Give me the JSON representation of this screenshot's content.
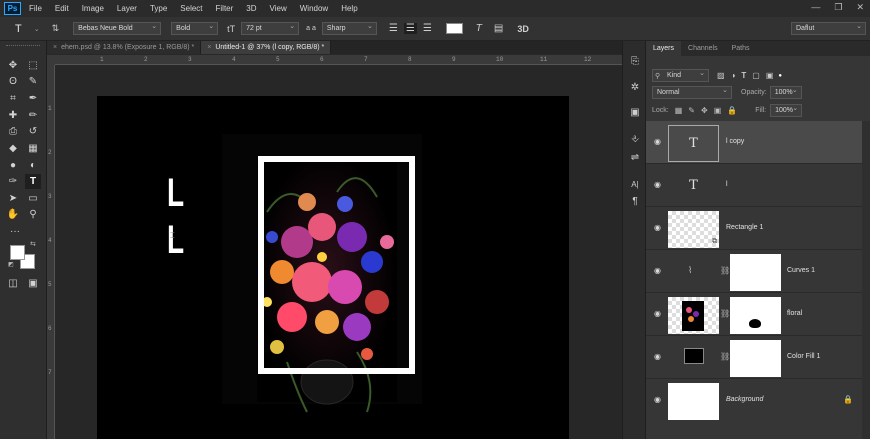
{
  "app": {
    "logo": "Ps"
  },
  "menu": [
    "File",
    "Edit",
    "Image",
    "Layer",
    "Type",
    "Select",
    "Filter",
    "3D",
    "View",
    "Window",
    "Help"
  ],
  "window_controls": {
    "minimize": "—",
    "restore": "❐",
    "close": "✕"
  },
  "options": {
    "tool_glyph": "T",
    "font_family": "Bebas Neue Bold",
    "font_style": "Bold",
    "size_glyph": "tT",
    "font_size": "72 pt",
    "aa_glyph": "a a",
    "antialias": "Sharp",
    "warp_glyph": "T",
    "panels_glyph": "▤",
    "threed_label": "3D",
    "workspace": "Daflut"
  },
  "tabs": [
    {
      "label": "ehem.psd @ 13.8% (Exposure 1, RGB/8) *",
      "close": "×",
      "active": false
    },
    {
      "label": "Untitled-1 @ 37% (l copy, RGB/8) *",
      "close": "×",
      "active": true
    }
  ],
  "ruler": {
    "top": [
      "1",
      "2",
      "3",
      "4",
      "5",
      "6",
      "7",
      "8",
      "9",
      "10",
      "11",
      "12"
    ],
    "left": [
      "1",
      "2",
      "3",
      "4",
      "5",
      "6",
      "7"
    ]
  },
  "toolbar": {
    "icons": [
      "move-icon",
      "marquee-icon",
      "lasso-icon",
      "quick-select-icon",
      "crop-icon",
      "eyedropper-icon",
      "healing-icon",
      "brush-icon",
      "stamp-icon",
      "history-brush-icon",
      "eraser-icon",
      "gradient-icon",
      "blur-icon",
      "dodge-icon",
      "pen-icon",
      "type-icon",
      "path-select-icon",
      "rectangle-icon",
      "hand-icon",
      "zoom-icon"
    ],
    "glyphs": [
      "✥",
      "⬚",
      "ʘ",
      "✎",
      "⌗",
      "✒",
      "✚",
      "✏",
      "⎙",
      "↺",
      "◆",
      "▦",
      "●",
      "◐",
      "✑",
      "T",
      "➤",
      "▭",
      "✋",
      "⚲"
    ],
    "more": "···",
    "foreground": "#ffffff",
    "background": "#ffffff"
  },
  "canvas": {
    "letters": [
      "L",
      "L"
    ],
    "frame_color": "#ffffff"
  },
  "strip": {
    "icons": [
      "history-icon",
      "properties-icon",
      "adjustments-icon",
      "brushes-icon",
      "sliders-icon",
      "character-icon",
      "paragraph-icon"
    ],
    "glyphs": [
      "⎘",
      "✲",
      "▣",
      "⎀",
      "⇌",
      "A|",
      "¶"
    ]
  },
  "panel": {
    "tabs": [
      "Layers",
      "Channels",
      "Paths"
    ],
    "filter_kind": "Kind",
    "blend_mode": "Normal",
    "opacity_label": "Opacity:",
    "opacity_value": "100%",
    "lock_label": "Lock:",
    "fill_label": "Fill:",
    "fill_value": "100%",
    "layers": [
      {
        "name": "l copy",
        "kind": "text",
        "thumb_text": "T",
        "selected": true
      },
      {
        "name": "l",
        "kind": "text",
        "thumb_text": "T",
        "selected": false
      },
      {
        "name": "Rectangle 1",
        "kind": "shape",
        "selected": false
      },
      {
        "name": "Curves 1",
        "kind": "adjustment",
        "selected": false
      },
      {
        "name": "floral",
        "kind": "image",
        "selected": false
      },
      {
        "name": "Color Fill 1",
        "kind": "fill",
        "selected": false
      },
      {
        "name": "Background",
        "kind": "background",
        "lock": "🔒",
        "selected": false
      }
    ],
    "eye": "◉",
    "chain": "⛓"
  }
}
